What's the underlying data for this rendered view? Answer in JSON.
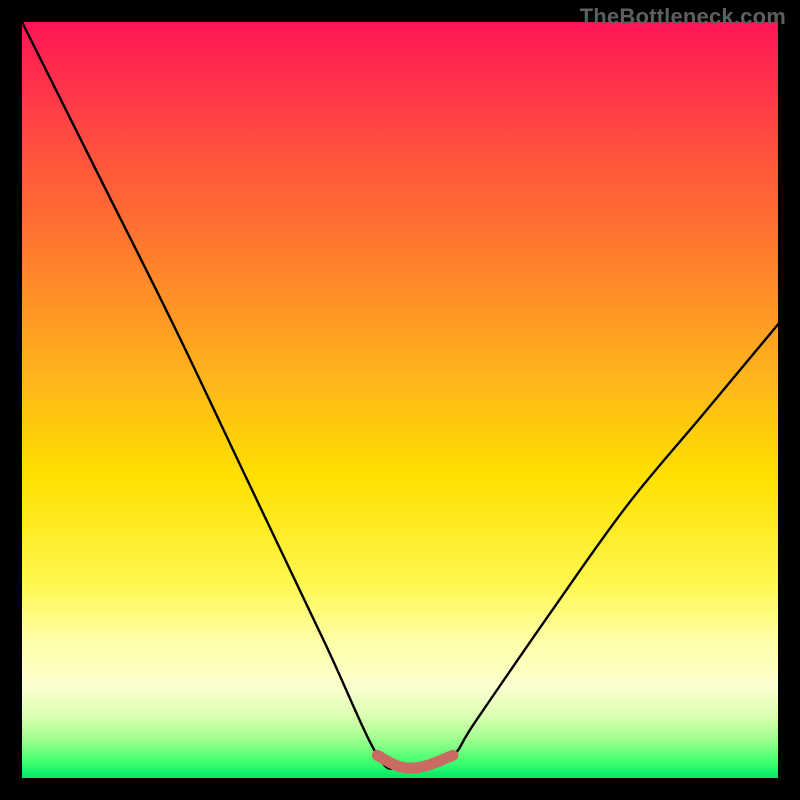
{
  "watermark": "TheBottleneck.com",
  "chart_data": {
    "type": "line",
    "title": "",
    "xlabel": "",
    "ylabel": "",
    "xlim": [
      0,
      100
    ],
    "ylim": [
      0,
      100
    ],
    "series": [
      {
        "name": "bottleneck-curve",
        "x": [
          0,
          10,
          20,
          30,
          40,
          47,
          50,
          53,
          57,
          60,
          70,
          80,
          90,
          100
        ],
        "values": [
          100,
          80,
          60,
          39,
          18,
          3,
          1.5,
          1.5,
          3,
          7.5,
          22,
          36,
          48,
          60
        ]
      },
      {
        "name": "optimal-band",
        "x": [
          47,
          50,
          53,
          57
        ],
        "values": [
          3,
          1.5,
          1.5,
          3
        ]
      }
    ],
    "gradient_stops": [
      {
        "pos": 0,
        "color": "#ff1457"
      },
      {
        "pos": 6,
        "color": "#ff2a4e"
      },
      {
        "pos": 16,
        "color": "#ff4d3f"
      },
      {
        "pos": 30,
        "color": "#ff7a2e"
      },
      {
        "pos": 46,
        "color": "#ffb11d"
      },
      {
        "pos": 60,
        "color": "#ffe000"
      },
      {
        "pos": 74,
        "color": "#fff74c"
      },
      {
        "pos": 82,
        "color": "#ffffa8"
      },
      {
        "pos": 88,
        "color": "#fcffd0"
      },
      {
        "pos": 92,
        "color": "#d9ffb0"
      },
      {
        "pos": 95,
        "color": "#9cff8e"
      },
      {
        "pos": 98,
        "color": "#3cff6e"
      },
      {
        "pos": 100,
        "color": "#00e667"
      }
    ],
    "colors": {
      "curve": "#000000",
      "optimal_band": "#c96a63",
      "frame": "#000000"
    }
  }
}
